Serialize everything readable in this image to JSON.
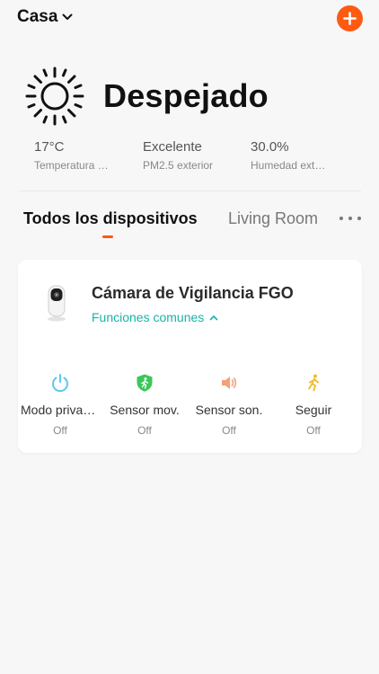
{
  "header": {
    "home_name": "Casa"
  },
  "weather": {
    "condition": "Despejado",
    "stats": [
      {
        "value": "17°C",
        "label": "Temperatura exterior"
      },
      {
        "value": "Excelente",
        "label": "PM2.5 exterior"
      },
      {
        "value": "30.0%",
        "label": "Humedad exterior"
      }
    ]
  },
  "tabs": {
    "active": "Todos los dispositivos",
    "inactive": "Living Room"
  },
  "device": {
    "name": "Cámara de Vigilancia FGO",
    "functions_label": "Funciones comunes",
    "functions": [
      {
        "label": "Modo privacidad",
        "status": "Off",
        "icon": "power-icon",
        "color": "#5ec8ee"
      },
      {
        "label": "Sensor mov.",
        "status": "Off",
        "icon": "motion-shield-icon",
        "color": "#3cc75a"
      },
      {
        "label": "Sensor son.",
        "status": "Off",
        "icon": "speaker-icon",
        "color": "#f4a07a"
      },
      {
        "label": "Seguir",
        "status": "Off",
        "icon": "running-person-icon",
        "color": "#f2bd32"
      }
    ]
  },
  "colors": {
    "accent": "#fe5a12",
    "link": "#19b3a7"
  }
}
